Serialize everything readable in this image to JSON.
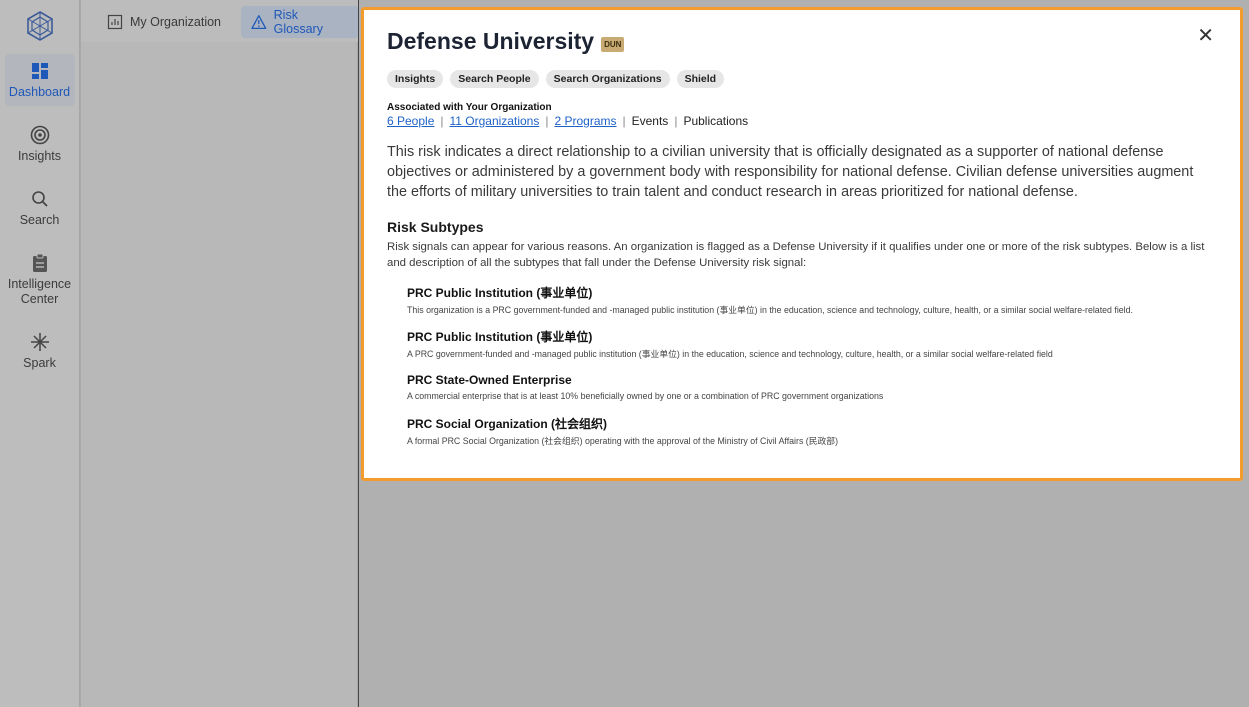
{
  "rail": {
    "items": [
      {
        "label": "Dashboard",
        "icon": "dashboard-icon"
      },
      {
        "label": "Insights",
        "icon": "target-icon"
      },
      {
        "label": "Search",
        "icon": "search-icon"
      },
      {
        "label": "Intelligence Center",
        "icon": "clipboard-icon"
      },
      {
        "label": "Spark",
        "icon": "spark-icon"
      }
    ]
  },
  "tabs": {
    "my_org": "My Organization",
    "risk_glossary": "Risk Glossary"
  },
  "modal": {
    "title": "Defense University",
    "code": "DUN",
    "chips": [
      "Insights",
      "Search People",
      "Search Organizations",
      "Shield"
    ],
    "assoc_label": "Associated with Your Organization",
    "assoc": {
      "people": "6 People",
      "orgs": "11 Organizations",
      "programs": "2 Programs",
      "events": "Events",
      "publications": "Publications"
    },
    "description": "This risk indicates a direct relationship to a civilian university that is officially designated as a supporter of national defense objectives or administered by a government body with responsibility for national defense. Civilian defense universities augment the efforts of military universities to train talent and conduct research in areas prioritized for national defense.",
    "subtypes_heading": "Risk Subtypes",
    "subtypes_intro": "Risk signals can appear for various reasons. An organization is flagged as a Defense University if it qualifies under one or more of the risk subtypes. Below is a list and description of all the subtypes that fall under the Defense University risk signal:",
    "subtypes": [
      {
        "title": "PRC Public Institution (事业单位)",
        "desc": "This organization is a PRC government-funded and -managed public institution (事业单位) in the education, science and technology, culture, health, or a similar social welfare-related field."
      },
      {
        "title": "PRC Public Institution (事业单位)",
        "desc": "A PRC government-funded and -managed public institution (事业单位) in the education, science and technology, culture, health, or a similar social welfare-related field"
      },
      {
        "title": "PRC State-Owned Enterprise",
        "desc": "A commercial enterprise that is at least 10% beneficially owned by one or a combination of PRC government organizations"
      },
      {
        "title": "PRC Social Organization (社会组织)",
        "desc": "A formal PRC Social Organization (社会组织) operating with the approval of the Ministry of Civil Affairs (民政部)"
      }
    ]
  },
  "colors": {
    "accent": "#1e58b8",
    "highlight_border": "#f39c2d",
    "badge": "#c8aa73"
  }
}
